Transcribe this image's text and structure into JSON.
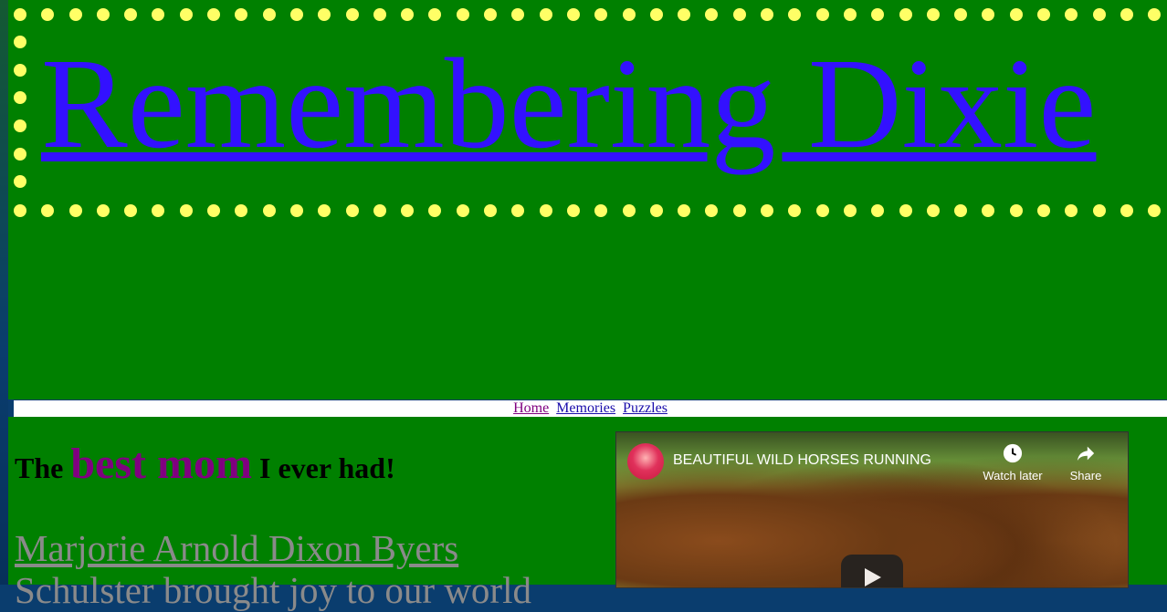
{
  "site": {
    "title": "Remembering Dixie"
  },
  "nav": {
    "items": [
      "Home",
      "Memories",
      "Puzzles"
    ]
  },
  "tagline": {
    "pre": "The ",
    "emphasis": "best mom",
    "post": " I ever had!"
  },
  "main": {
    "name_link": "Marjorie Arnold Dixon Byers",
    "subtext": "Schulster brought joy to our world"
  },
  "video": {
    "title": "BEAUTIFUL WILD HORSES RUNNING",
    "watch_later": "Watch later",
    "share": "Share"
  },
  "colors": {
    "background": "#008000",
    "dots": "#ffff66",
    "title": "#3311ff",
    "emphasis": "#800080",
    "link_gray": "#8a8a8a"
  }
}
